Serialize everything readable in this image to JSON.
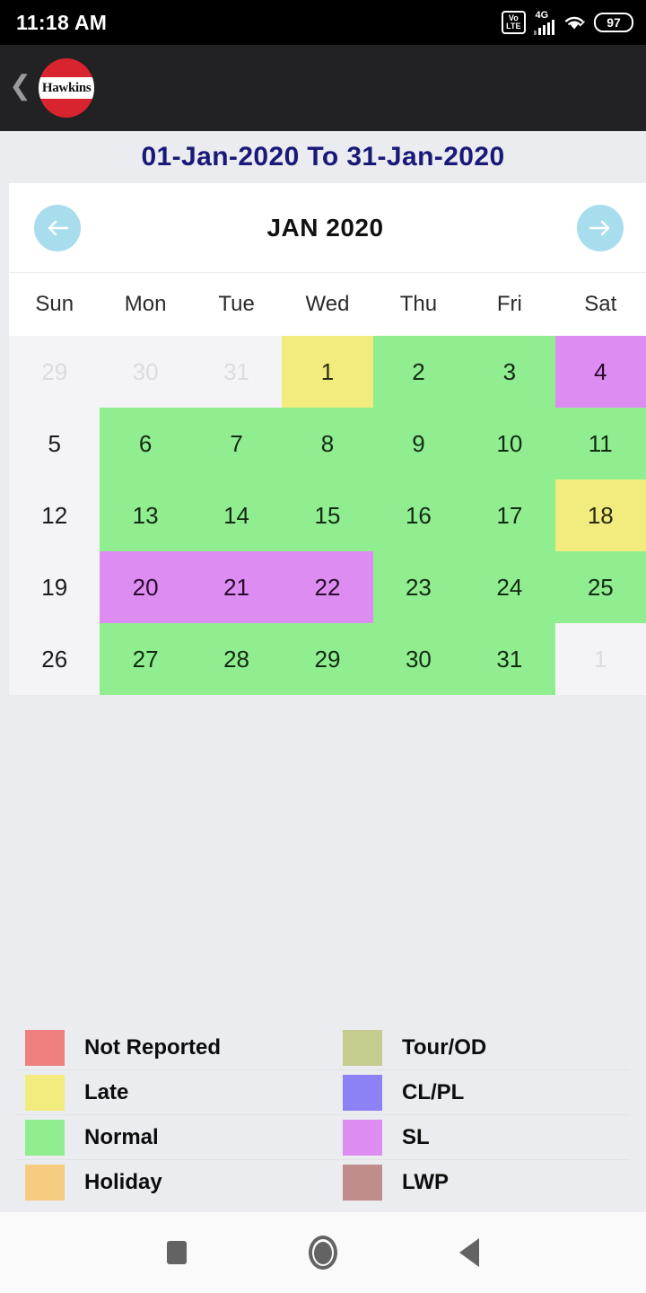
{
  "status_bar": {
    "time": "11:18 AM",
    "volte_top": "Vo",
    "volte_bottom": "LTE",
    "network_type": "4G",
    "battery_level": "97"
  },
  "app_bar": {
    "back_label": "❮",
    "logo_text": "Hawkins"
  },
  "range_title": "01-Jan-2020  To  31-Jan-2020",
  "calendar": {
    "month_label": "JAN 2020",
    "prev_label": "←",
    "next_label": "→",
    "day_headers": [
      "Sun",
      "Mon",
      "Tue",
      "Wed",
      "Thu",
      "Fri",
      "Sat"
    ],
    "weeks": [
      [
        {
          "day": "29",
          "status": "out"
        },
        {
          "day": "30",
          "status": "out"
        },
        {
          "day": "31",
          "status": "out"
        },
        {
          "day": "1",
          "status": "late"
        },
        {
          "day": "2",
          "status": "normal"
        },
        {
          "day": "3",
          "status": "normal"
        },
        {
          "day": "4",
          "status": "sl"
        }
      ],
      [
        {
          "day": "5",
          "status": "none"
        },
        {
          "day": "6",
          "status": "normal"
        },
        {
          "day": "7",
          "status": "normal"
        },
        {
          "day": "8",
          "status": "normal"
        },
        {
          "day": "9",
          "status": "normal"
        },
        {
          "day": "10",
          "status": "normal"
        },
        {
          "day": "11",
          "status": "normal"
        }
      ],
      [
        {
          "day": "12",
          "status": "none"
        },
        {
          "day": "13",
          "status": "normal"
        },
        {
          "day": "14",
          "status": "normal"
        },
        {
          "day": "15",
          "status": "normal"
        },
        {
          "day": "16",
          "status": "normal"
        },
        {
          "day": "17",
          "status": "normal"
        },
        {
          "day": "18",
          "status": "late"
        }
      ],
      [
        {
          "day": "19",
          "status": "none"
        },
        {
          "day": "20",
          "status": "sl"
        },
        {
          "day": "21",
          "status": "sl"
        },
        {
          "day": "22",
          "status": "sl"
        },
        {
          "day": "23",
          "status": "normal"
        },
        {
          "day": "24",
          "status": "normal"
        },
        {
          "day": "25",
          "status": "normal"
        }
      ],
      [
        {
          "day": "26",
          "status": "none"
        },
        {
          "day": "27",
          "status": "normal"
        },
        {
          "day": "28",
          "status": "normal"
        },
        {
          "day": "29",
          "status": "normal"
        },
        {
          "day": "30",
          "status": "normal"
        },
        {
          "day": "31",
          "status": "normal"
        },
        {
          "day": "1",
          "status": "out"
        }
      ]
    ]
  },
  "legend": {
    "left": [
      {
        "label": "Not Reported",
        "color": "#F08080"
      },
      {
        "label": "Late",
        "color": "#F2EC7E"
      },
      {
        "label": "Normal",
        "color": "#90EE90"
      },
      {
        "label": "Holiday",
        "color": "#F5CC80"
      }
    ],
    "right": [
      {
        "label": "Tour/OD",
        "color": "#C5CC8E"
      },
      {
        "label": "CL/PL",
        "color": "#8C82F5"
      },
      {
        "label": "SL",
        "color": "#DD8CF2"
      },
      {
        "label": "LWP",
        "color": "#C08C8C"
      }
    ]
  },
  "android_nav": {
    "recents": "recents",
    "home": "home",
    "back": "back"
  }
}
